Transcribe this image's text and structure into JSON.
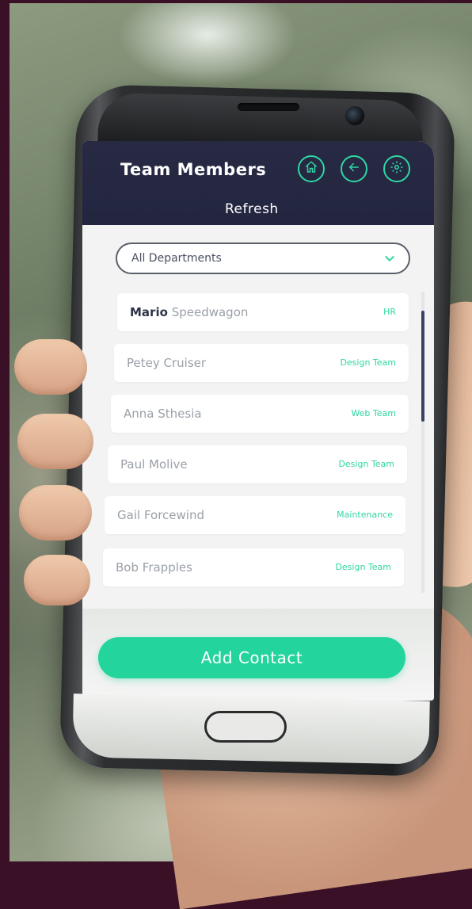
{
  "app": {
    "title": "Team Members",
    "refresh_label": "Refresh",
    "accent_color": "#2fd6a3",
    "header_color": "#262940"
  },
  "header_icons": [
    "home-icon",
    "back-arrow-icon",
    "gear-icon"
  ],
  "filter": {
    "selected": "All Departments"
  },
  "members": [
    {
      "first": "Mario",
      "last": "Speedwagon",
      "department": "HR"
    },
    {
      "first": "Petey",
      "last": "Cruiser",
      "department": "Design Team"
    },
    {
      "first": "Anna",
      "last": "Sthesia",
      "department": "Web Team"
    },
    {
      "first": "Paul",
      "last": "Molive",
      "department": "Design Team"
    },
    {
      "first": "Gail",
      "last": "Forcewind",
      "department": "Maintenance"
    },
    {
      "first": "Bob",
      "last": "Frapples",
      "department": "Design Team"
    }
  ],
  "footer": {
    "add_label": "Add Contact"
  }
}
